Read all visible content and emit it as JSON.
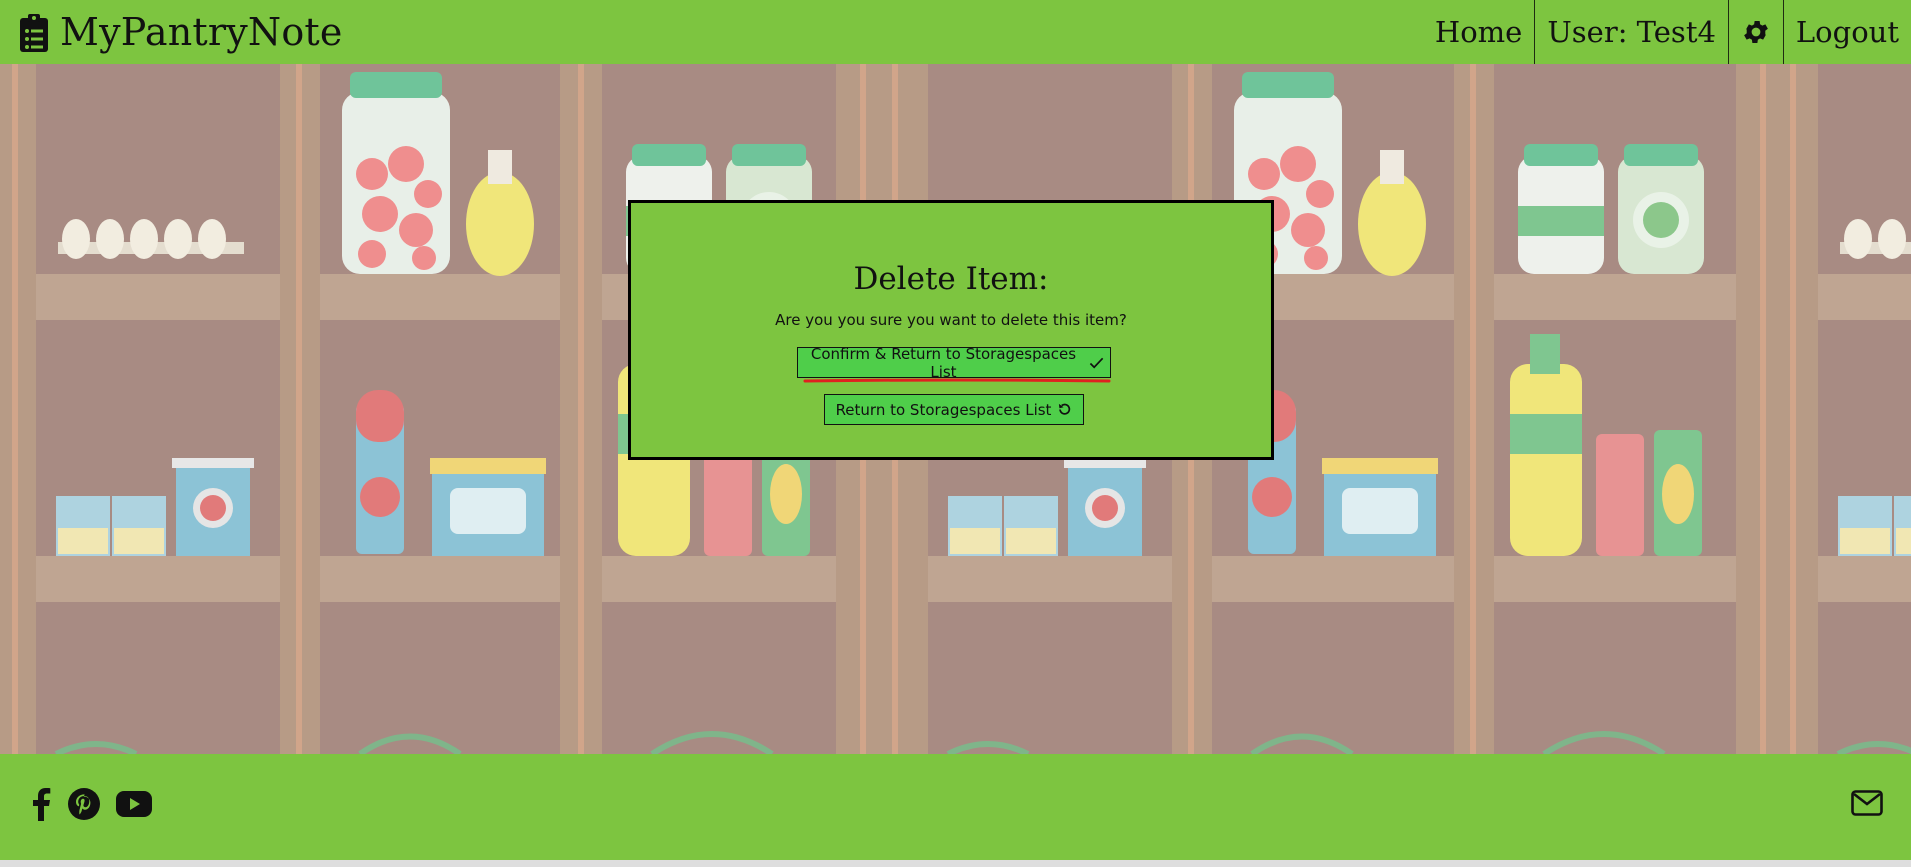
{
  "header": {
    "brand": "MyPantryNote",
    "nav": {
      "home": "Home",
      "user": "User: Test4",
      "logout": "Logout"
    }
  },
  "modal": {
    "title": "Delete Item:",
    "question": "Are you you sure you want to delete this item?",
    "confirm_label": "Confirm & Return to Storagespaces List",
    "return_label": "Return to Storagespaces List"
  },
  "icons": {
    "brand": "clipboard-list-icon",
    "settings": "gear-icon",
    "confirm": "check-icon",
    "return": "undo-icon",
    "social": [
      "facebook-icon",
      "pinterest-icon",
      "youtube-icon"
    ],
    "contact": "envelope-icon"
  },
  "colors": {
    "brand_green": "#7dc540",
    "button_green": "#4fce4a",
    "underline_red": "#e02020"
  }
}
